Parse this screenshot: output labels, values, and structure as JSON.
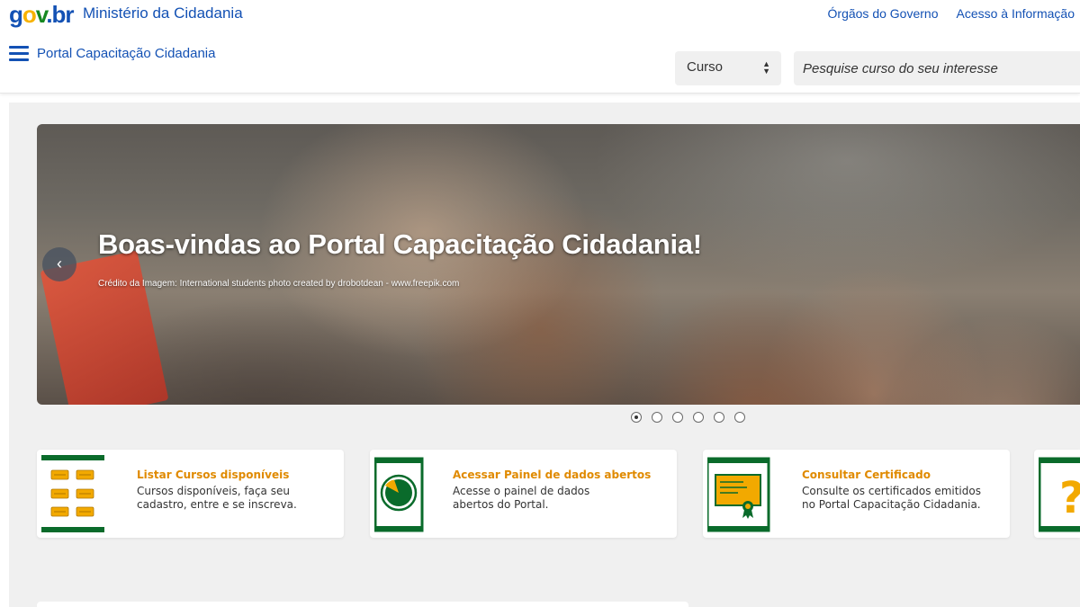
{
  "header": {
    "logo": {
      "g": "g",
      "o": "o",
      "v": "v",
      "dot": ".",
      "br": "br"
    },
    "ministry": "Ministério da Cidadania",
    "links": [
      "Órgãos do Governo",
      "Acesso à Informação"
    ],
    "portal_title": "Portal Capacitação Cidadania",
    "select_value": "Curso",
    "search_placeholder": "Pesquise curso do seu interesse"
  },
  "carousel": {
    "title": "Boas-vindas ao Portal Capacitação Cidadania!",
    "credit": "Crédito da Imagem: International students photo created by drobotdean - www.freepik.com",
    "prev_label": "‹",
    "slides_count": 6,
    "active_slide": 1
  },
  "cards": [
    {
      "title": "Listar Cursos disponíveis",
      "desc": "Cursos disponíveis, faça seu cadastro, entre e se inscreva.",
      "icon": "course-list-icon"
    },
    {
      "title": "Acessar Painel de dados abertos",
      "desc": "Acesse o painel de dados abertos do Portal.",
      "icon": "pie-chart-icon"
    },
    {
      "title": "Consultar Certificado",
      "desc": "Consulte os certificados emitidos no Portal Capacitação Cidadania.",
      "icon": "certificate-icon"
    },
    {
      "title": "",
      "desc": "",
      "icon": "question-icon"
    }
  ],
  "colors": {
    "brand_blue": "#1351b4",
    "green": "#0a6b2b",
    "orange": "#e08a00",
    "yellow": "#f2a900"
  }
}
